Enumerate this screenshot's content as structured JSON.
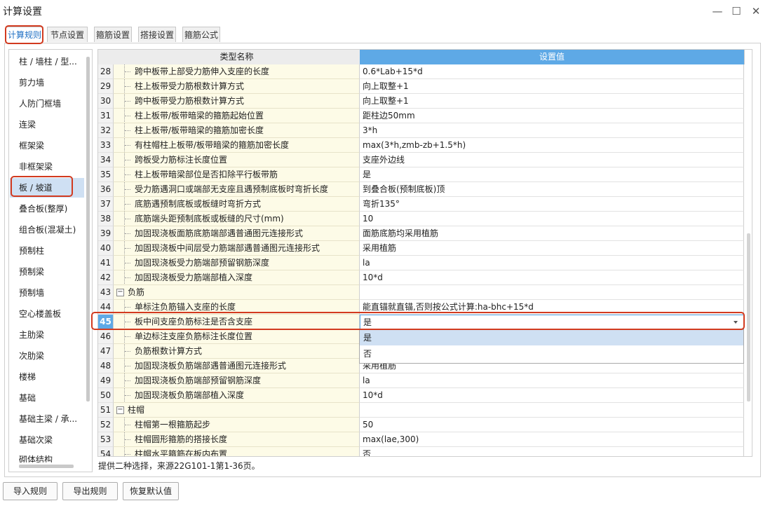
{
  "window": {
    "title": "计算设置",
    "minimize_icon": "—",
    "maximize_icon": "☐",
    "close_icon": "✕"
  },
  "tabs": [
    {
      "label": "计算规则",
      "active": true
    },
    {
      "label": "节点设置"
    },
    {
      "label": "箍筋设置"
    },
    {
      "label": "搭接设置"
    },
    {
      "label": "箍筋公式"
    }
  ],
  "sidebar": {
    "items": [
      "柱 / 墙柱 / 型...",
      "剪力墙",
      "人防门框墙",
      "连梁",
      "框架梁",
      "非框架梁",
      "板 / 坡道",
      "叠合板(整厚)",
      "组合板(混凝土)",
      "预制柱",
      "预制梁",
      "预制墙",
      "空心楼盖板",
      "主肋梁",
      "次肋梁",
      "楼梯",
      "基础",
      "基础主梁 / 承...",
      "基础次梁",
      "砌体结构"
    ],
    "selected_index": 6
  },
  "grid": {
    "header_name": "类型名称",
    "header_value": "设置值",
    "rows": [
      {
        "num": "28",
        "name": "跨中板带上部受力筋伸入支座的长度",
        "value": "0.6*Lab+15*d"
      },
      {
        "num": "29",
        "name": "柱上板带受力筋根数计算方式",
        "value": "向上取整+1"
      },
      {
        "num": "30",
        "name": "跨中板带受力筋根数计算方式",
        "value": "向上取整+1"
      },
      {
        "num": "31",
        "name": "柱上板带/板带暗梁的箍筋起始位置",
        "value": "距柱边50mm"
      },
      {
        "num": "32",
        "name": "柱上板带/板带暗梁的箍筋加密长度",
        "value": "3*h"
      },
      {
        "num": "33",
        "name": "有柱帽柱上板带/板带暗梁的箍筋加密长度",
        "value": "max(3*h,zmb-zb+1.5*h)"
      },
      {
        "num": "34",
        "name": "跨板受力筋标注长度位置",
        "value": "支座外边线"
      },
      {
        "num": "35",
        "name": "柱上板带暗梁部位是否扣除平行板带筋",
        "value": "是"
      },
      {
        "num": "36",
        "name": "受力筋遇洞口或端部无支座且遇预制底板时弯折长度",
        "value": "到叠合板(预制底板)顶"
      },
      {
        "num": "37",
        "name": "底筋遇预制底板或板缝时弯折方式",
        "value": "弯折135°"
      },
      {
        "num": "38",
        "name": "底筋端头距预制底板或板缝的尺寸(mm)",
        "value": "10"
      },
      {
        "num": "39",
        "name": "加固现浇板面筋底筋端部遇普通图元连接形式",
        "value": "面筋底筋均采用植筋"
      },
      {
        "num": "40",
        "name": "加固现浇板中间层受力筋端部遇普通图元连接形式",
        "value": "采用植筋"
      },
      {
        "num": "41",
        "name": "加固现浇板受力筋端部预留钢筋深度",
        "value": "la"
      },
      {
        "num": "42",
        "name": "加固现浇板受力筋端部植入深度",
        "value": "10*d"
      },
      {
        "num": "43",
        "name": "负筋",
        "value": "",
        "group": true
      },
      {
        "num": "44",
        "name": "单标注负筋锚入支座的长度",
        "value": "能直锚就直锚,否则按公式计算:ha-bhc+15*d"
      },
      {
        "num": "45",
        "name": "板中间支座负筋标注是否含支座",
        "value": "是",
        "active": true
      },
      {
        "num": "46",
        "name": "单边标注支座负筋标注长度位置",
        "value": ""
      },
      {
        "num": "47",
        "name": "负筋根数计算方式",
        "value": ""
      },
      {
        "num": "48",
        "name": "加固现浇板负筋端部遇普通图元连接形式",
        "value": "采用植筋"
      },
      {
        "num": "49",
        "name": "加固现浇板负筋端部预留钢筋深度",
        "value": "la"
      },
      {
        "num": "50",
        "name": "加固现浇板负筋端部植入深度",
        "value": "10*d"
      },
      {
        "num": "51",
        "name": "柱帽",
        "value": "",
        "group": true
      },
      {
        "num": "52",
        "name": "柱帽第一根箍筋起步",
        "value": "50"
      },
      {
        "num": "53",
        "name": "柱帽圆形箍筋的搭接长度",
        "value": "max(lae,300)"
      },
      {
        "num": "54",
        "name": "柱帽水平箍筋在板内布置",
        "value": "否"
      }
    ]
  },
  "dropdown": {
    "options": [
      "是",
      "否"
    ],
    "selected_index": 0
  },
  "status_text": "提供二种选择，来源22G101-1第1-36页。",
  "buttons": {
    "import": "导入规则",
    "export": "导出规则",
    "restore": "恢复默认值"
  },
  "colors": {
    "accent": "#5ea9e6",
    "highlight_border": "#d23a1f",
    "name_cell_bg": "#fdfbe7",
    "selected_bg": "#cfe0f3"
  }
}
